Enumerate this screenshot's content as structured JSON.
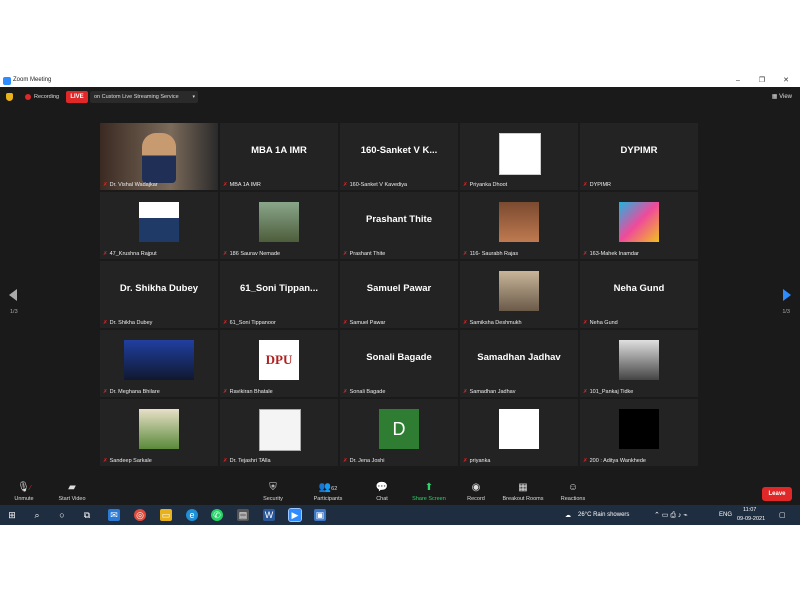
{
  "window": {
    "title": "Zoom Meeting",
    "min": "–",
    "max": "❐",
    "close": "✕"
  },
  "topbar": {
    "recording_label": "Recording",
    "live_label": "LIVE",
    "stream_label": "on Custom Live Streaming Service",
    "view_label": "View"
  },
  "nav": {
    "left_page": "1/3",
    "right_page": "1/3"
  },
  "tiles": [
    {
      "name": "Dr. Vishal Wadajkar",
      "big": "",
      "kind": "video-person"
    },
    {
      "name": "MBA 1A IMR",
      "big": "MBA 1A IMR",
      "kind": "text"
    },
    {
      "name": "160-Sanket V Kavediya",
      "big": "160-Sanket V K...",
      "kind": "text"
    },
    {
      "name": "Priyanka Dhoot",
      "big": "",
      "kind": "image-slide"
    },
    {
      "name": "DYPIMR",
      "big": "DYPIMR",
      "kind": "text"
    },
    {
      "name": "47_Krushna Rajput",
      "big": "",
      "kind": "image-person"
    },
    {
      "name": "186 Saurav Nemade",
      "big": "",
      "kind": "image-stones"
    },
    {
      "name": "Prashant Thite",
      "big": "Prashant Thite",
      "kind": "text"
    },
    {
      "name": "116- Saurabh Rajas",
      "big": "",
      "kind": "image-person2"
    },
    {
      "name": "163-Mahek Inamdar",
      "big": "",
      "kind": "image-feather"
    },
    {
      "name": "Dr. Shikha Dubey",
      "big": "Dr. Shikha Dubey",
      "kind": "text"
    },
    {
      "name": "61_Soni Tippanoor",
      "big": "61_Soni Tippan...",
      "kind": "text"
    },
    {
      "name": "Samuel Pawar",
      "big": "Samuel Pawar",
      "kind": "text"
    },
    {
      "name": "Samiksha Deshmukh",
      "big": "",
      "kind": "image-person3"
    },
    {
      "name": "Neha Gund",
      "big": "Neha Gund",
      "kind": "text"
    },
    {
      "name": "Dr. Meghana Bhilare",
      "big": "",
      "kind": "image-stage"
    },
    {
      "name": "Ravikiran Bhatale",
      "big": "",
      "kind": "image-dpu",
      "logo_text": "DPU"
    },
    {
      "name": "Sonali Bagade",
      "big": "Sonali Bagade",
      "kind": "text"
    },
    {
      "name": "Samadhan Jadhav",
      "big": "Samadhan Jadhav",
      "kind": "text"
    },
    {
      "name": "101_Pankaj Tidke",
      "big": "",
      "kind": "image-person4"
    },
    {
      "name": "Sandeep Sarkale",
      "big": "",
      "kind": "image-books"
    },
    {
      "name": "Dr. Tejashri TAlla",
      "big": "",
      "kind": "image-doc"
    },
    {
      "name": "Dr. Jena Joshi",
      "big": "",
      "kind": "image-letter",
      "letter": "D"
    },
    {
      "name": "priyanka",
      "big": "",
      "kind": "image-white"
    },
    {
      "name": "200 : Aditya Wankhede",
      "big": "",
      "kind": "image-black"
    }
  ],
  "toolbar": {
    "unmute": "Unmute",
    "start_video": "Start Video",
    "security": "Security",
    "participants": "Participants",
    "participants_count": "62",
    "chat": "Chat",
    "share_screen": "Share Screen",
    "record": "Record",
    "breakout": "Breakout Rooms",
    "reactions": "Reactions",
    "leave": "Leave"
  },
  "taskbar": {
    "weather": "26°C  Rain showers",
    "lang": "ENG",
    "time": "11:07",
    "date": "09-09-2021"
  },
  "colors": {
    "accent": "#2d8cff",
    "live": "#e02828",
    "active_border": "#b9e23a",
    "share_green": "#2ed36a"
  }
}
